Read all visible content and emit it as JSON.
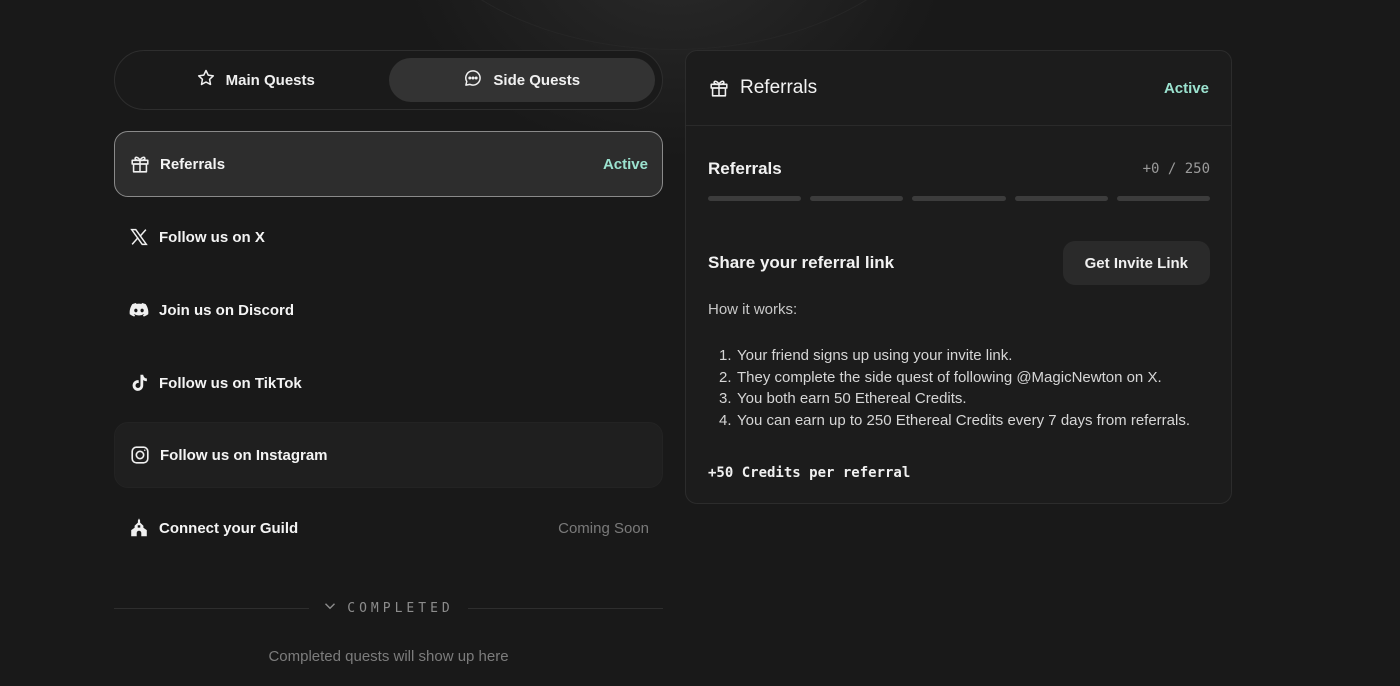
{
  "tabs": [
    {
      "label": "Main Quests",
      "icon": "star-icon",
      "selected": false
    },
    {
      "label": "Side Quests",
      "icon": "chat-bubble-icon",
      "selected": true
    }
  ],
  "quests": [
    {
      "label": "Referrals",
      "icon": "gift-icon",
      "status": "Active"
    },
    {
      "label": "Follow us on X",
      "icon": "x-logo-icon",
      "status": ""
    },
    {
      "label": "Join us on Discord",
      "icon": "discord-icon",
      "status": ""
    },
    {
      "label": "Follow us on TikTok",
      "icon": "tiktok-icon",
      "status": ""
    },
    {
      "label": "Follow us on Instagram",
      "icon": "instagram-icon",
      "status": ""
    },
    {
      "label": "Connect your Guild",
      "icon": "guild-icon",
      "status": "Coming Soon"
    }
  ],
  "completed": {
    "label": "COMPLETED",
    "empty_text": "Completed quests will show up here"
  },
  "panel": {
    "title": "Referrals",
    "status": "Active",
    "progress_label": "Referrals",
    "progress_count": "+0 / 250",
    "progress_fraction": 0,
    "share_title": "Share your referral link",
    "invite_button": "Get Invite Link",
    "how_title": "How it works:",
    "steps": [
      "Your friend signs up using your invite link.",
      "They complete the side quest of following @MagicNewton on X.",
      "You both earn 50 Ethereal Credits.",
      "You can earn up to 250 Ethereal Credits every 7 days from referrals."
    ],
    "credits_note": "+50 Credits per referral"
  },
  "colors": {
    "background": "#191919",
    "accent_active": "#9be2cf",
    "muted": "#7a7a7a"
  }
}
